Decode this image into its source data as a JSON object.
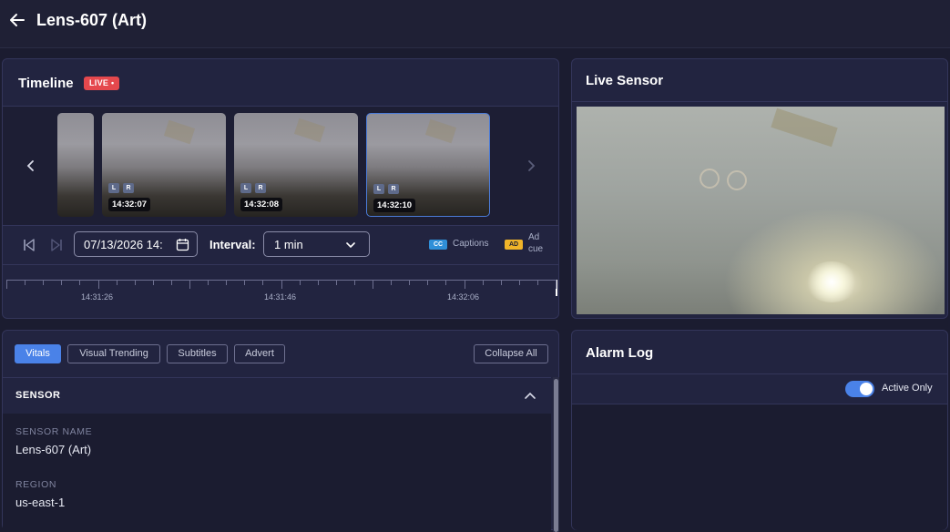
{
  "header": {
    "title": "Lens-607 (Art)"
  },
  "timeline": {
    "title": "Timeline",
    "live_badge": "LIVE •",
    "thumbnails": [
      {
        "time": "14:32:07",
        "tags": [
          "L",
          "R"
        ],
        "selected": false
      },
      {
        "time": "14:32:08",
        "tags": [
          "L",
          "R"
        ],
        "selected": false
      },
      {
        "time": "14:32:10",
        "tags": [
          "L",
          "R"
        ],
        "selected": true
      }
    ],
    "date_value": "07/13/2026 14:",
    "interval_label": "Interval:",
    "interval_value": "1 min",
    "cc_badge": "CC",
    "cc_label": "Captions",
    "ad_badge": "AD",
    "ad_label": "Ad cue",
    "ruler_labels": [
      "14:31:26",
      "14:31:46",
      "14:32:06"
    ]
  },
  "live_sensor": {
    "title": "Live Sensor"
  },
  "detail": {
    "tabs": [
      {
        "label": "Vitals",
        "active": true
      },
      {
        "label": "Visual Trending",
        "active": false
      },
      {
        "label": "Subtitles",
        "active": false
      },
      {
        "label": "Advert",
        "active": false
      }
    ],
    "collapse_all": "Collapse All",
    "section_title": "SENSOR",
    "fields": [
      {
        "label": "SENSOR NAME",
        "value": "Lens-607 (Art)"
      },
      {
        "label": "REGION",
        "value": "us-east-1"
      }
    ]
  },
  "alarm_log": {
    "title": "Alarm Log",
    "toggle_label": "Active Only",
    "toggle_on": true
  },
  "colors": {
    "accent": "#4a82e8",
    "live": "#e5484d",
    "cc": "#2f8fd8",
    "ad": "#f0b429"
  }
}
